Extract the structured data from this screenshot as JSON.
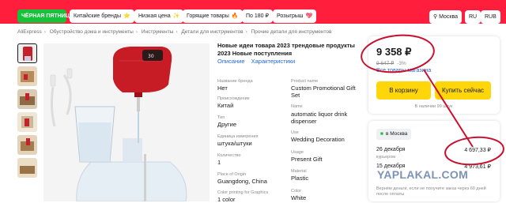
{
  "promo": {
    "black_friday": "ЧЁРНАЯ ПЯТНИЦА",
    "chips": [
      {
        "label": "Китайские бренды",
        "emoji": "⭐"
      },
      {
        "label": "Низкая цена",
        "emoji": "✨"
      },
      {
        "label": "Горящие товары",
        "emoji": "🔥"
      },
      {
        "label": "По 180 ₽",
        "emoji": ""
      },
      {
        "label": "Розыгрыш",
        "emoji": "💖"
      }
    ],
    "location": "Москва",
    "lang": "RU",
    "currency": "RUB"
  },
  "breadcrumb": [
    "AliExpress",
    "Обустройство дома и инструменты",
    "Инструменты",
    "Детали для инструментов",
    "Прочие детали для инструментов"
  ],
  "product": {
    "title": "Новые идеи товара 2023 трендовые продукты 2023 Новые поступления",
    "tab_description": "Описание",
    "tab_characteristics": "Характеристики",
    "specs": [
      {
        "label": "Название бренда",
        "value": "Нет"
      },
      {
        "label": "Product name",
        "value": "Custom Promotional Gift"
      },
      {
        "label": "",
        "value": "Set"
      },
      {
        "label": "Происхождение",
        "value": "Китай"
      },
      {
        "label": "Name",
        "value": "automatic liquor drink"
      },
      {
        "label": "",
        "value": "dispenser"
      },
      {
        "label": "Тип",
        "value": "Другие"
      },
      {
        "label": "Единица измерения",
        "value": "штука/штуки"
      },
      {
        "label": "Use",
        "value": "Wedding Decoration"
      },
      {
        "label": "Количество",
        "value": "1"
      },
      {
        "label": "Usage",
        "value": "Present Gift"
      },
      {
        "label": "Place of Origin",
        "value": "Guangdong, China"
      },
      {
        "label": "Material",
        "value": "Plastic"
      },
      {
        "label": "Color printing for Graphics",
        "value": "1 color"
      },
      {
        "label": "Color",
        "value": "White"
      }
    ]
  },
  "buy": {
    "price": "9 358 ₽",
    "old_price": "9 647 ₽",
    "discount": "-3%",
    "store_link": "Все товары магазина",
    "add_to_cart": "В корзину",
    "buy_now": "Купить сейчас",
    "stock": "В наличии 99 штук"
  },
  "delivery": {
    "location": "в Москва",
    "options": [
      {
        "date": "26 декабря",
        "price": "4 697,33 ₽",
        "sub": "курьером"
      },
      {
        "date": "15 декабря",
        "price": "4 973,61 ₽",
        "sub": ""
      }
    ],
    "note": "Вернём деньги, если не получите заказ через 60 дней после оплаты"
  },
  "watermark": "YAPLAKAL.COM",
  "colors": {
    "promo_bg": "#ff1e3c",
    "black_friday": "#16c23a",
    "button": "#ffd60a",
    "link": "#2467d6",
    "annotation": "#c8102e"
  }
}
